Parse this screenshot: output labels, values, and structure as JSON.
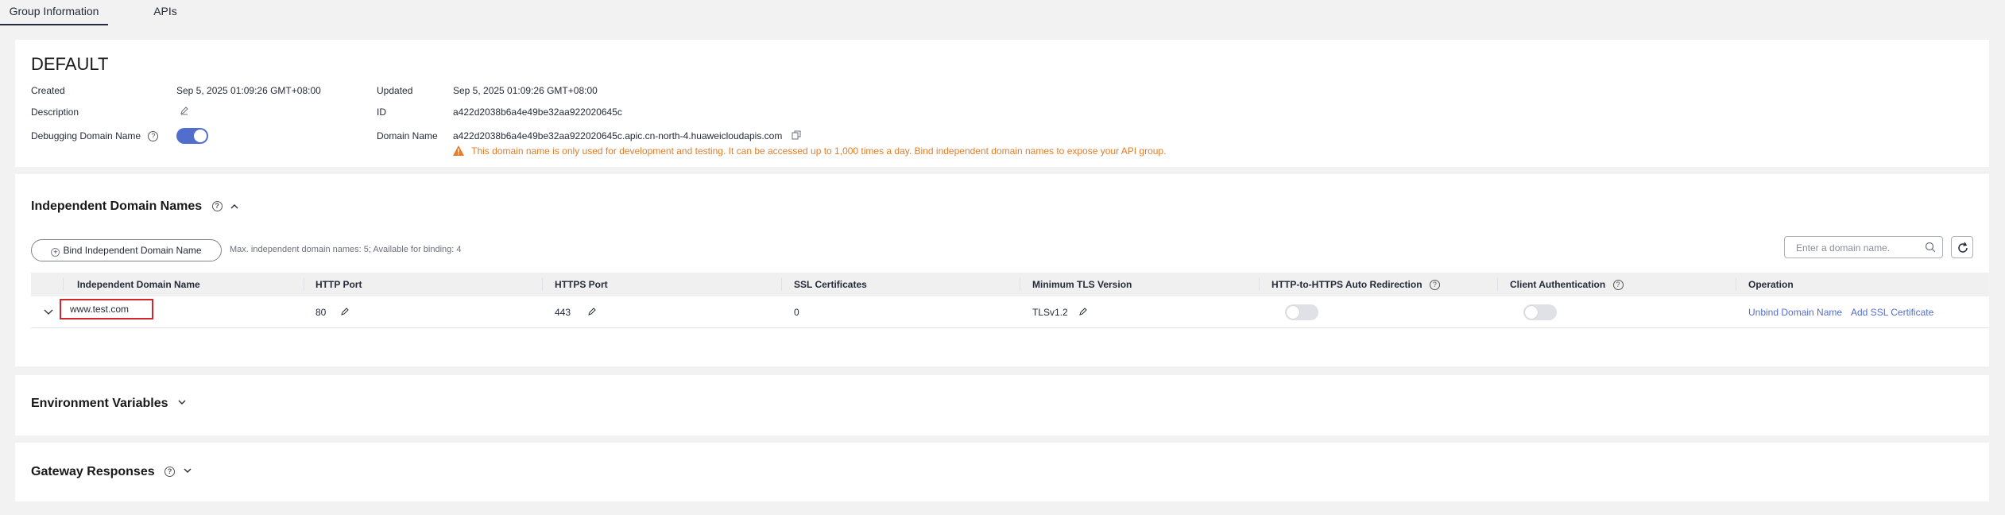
{
  "tabs": [
    {
      "label": "Group Information"
    },
    {
      "label": "APIs"
    }
  ],
  "group": {
    "name": "DEFAULT",
    "created_label": "Created",
    "created_value": "Sep 5, 2025 01:09:26 GMT+08:00",
    "updated_label": "Updated",
    "updated_value": "Sep 5, 2025 01:09:26 GMT+08:00",
    "description_label": "Description",
    "id_label": "ID",
    "id_value": "a422d2038b6a4e49be32aa922020645c",
    "debug_label": "Debugging Domain Name",
    "debug_enabled": true,
    "domain_label": "Domain Name",
    "domain_value": "a422d2038b6a4e49be32aa922020645c.apic.cn-north-4.huaweicloudapis.com",
    "warning": "This domain name is only used for development and testing. It can be accessed up to 1,000 times a day. Bind independent domain names to expose your API group."
  },
  "independent": {
    "title": "Independent Domain Names",
    "bind_button": "Bind Independent Domain Name",
    "quota": "Max. independent domain names: 5; Available for binding: 4",
    "search_placeholder": "Enter a domain name.",
    "columns": [
      "Independent Domain Name",
      "HTTP Port",
      "HTTPS Port",
      "SSL Certificates",
      "Minimum TLS Version",
      "HTTP-to-HTTPS Auto Redirection",
      "Client Authentication",
      "Operation"
    ],
    "rows": [
      {
        "domain": "www.test.com",
        "http_port": "80",
        "https_port": "443",
        "ssl": "0",
        "tls": "TLSv1.2",
        "redirect_enabled": false,
        "client_auth_enabled": false,
        "op_unbind": "Unbind Domain Name",
        "op_add_ssl": "Add SSL Certificate"
      }
    ]
  },
  "env_vars": {
    "title": "Environment Variables"
  },
  "gateway": {
    "title": "Gateway Responses"
  },
  "colors": {
    "accent": "#526ecc",
    "warning": "#e37d29",
    "highlight_border": "#d0262f"
  }
}
